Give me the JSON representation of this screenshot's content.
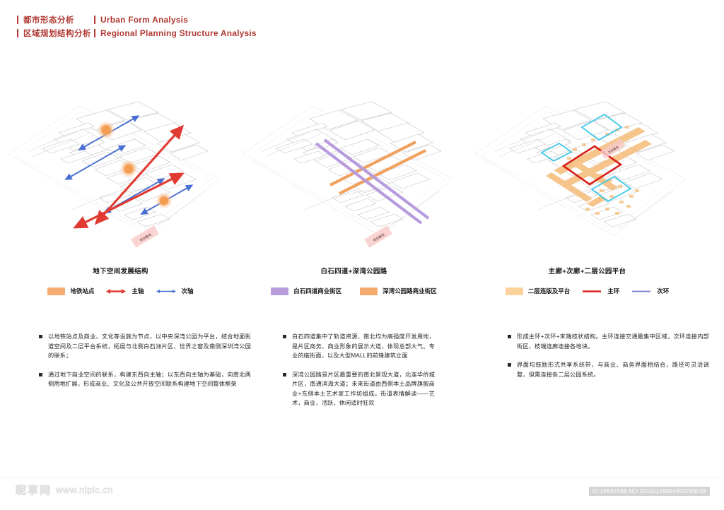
{
  "header": {
    "rows": [
      {
        "cn": "都市形态分析",
        "en": "Urban Form Analysis"
      },
      {
        "cn": "区域规划结构分析",
        "en": "Regional Planning Structure Analysis"
      }
    ],
    "accent_color": "#b03a34"
  },
  "panels": [
    {
      "title": "地下空间发展结构",
      "site_label": "项目基地",
      "legend": [
        {
          "kind": "swatch",
          "label": "地铁站点",
          "color": "#f5ad72"
        },
        {
          "kind": "double-arrow",
          "label": "主轴",
          "color": "#e03a32"
        },
        {
          "kind": "double-arrow",
          "label": "次轴",
          "color": "#4a6fd4"
        }
      ]
    },
    {
      "title": "白石四道+深湾公园路",
      "site_label": "项目基地",
      "legend": [
        {
          "kind": "swatch",
          "label": "白石四道商业街区",
          "color": "#b79bdd"
        },
        {
          "kind": "swatch",
          "label": "深湾公园路商业街区",
          "color": "#f3ab6e"
        }
      ]
    },
    {
      "title": "主廊+次廊+二层公园平台",
      "site_label": "项目基地",
      "legend": [
        {
          "kind": "swatch",
          "label": "二层连版及平台",
          "color": "#fbd29a"
        },
        {
          "kind": "line",
          "label": "主环",
          "color": "#d8201b"
        },
        {
          "kind": "line",
          "label": "次环",
          "color": "#6f7fd8"
        }
      ]
    }
  ],
  "notes": {
    "column1": [
      "以地铁站点及商业、文化等设施为节点，以中央深湾公园为平台，结合地面街道空间及二层平台系统，拓展与北侧白石洲片区、世界之窗及南侧深圳湾公园的联系；",
      "通过地下商业空间的联系，构建东西向主轴；以东西向主轴为基础，向南北两侧用地扩展，形成商业、文化及公共开放空间联系构建地下空间整体框架"
    ],
    "column2": [
      "白石四道集中了轨道资源，南北均为高强度开发用地，是片区商务、商业形象的展示大道，体现总部大气、专业的临街面，以及大型MALL的前锋建筑立面",
      "深湾公园路是片区最重要的南北景观大道，北连华侨城片区，南通滨海大道；未来街道由西侧本土品牌旗舰商业+东侧本土艺术家工作坊组成。街道表情解读——艺术，商业，活跃，休闲适时狂欢"
    ],
    "column3": [
      "形成主环+次环+末端枝状结构。主环连接交通最集中区域，次环连接内部街区，枝端连廊连接各地块。",
      "界面均鼓励形式共享系统带，与商业、商务界面相结合，路径可灵活调整，但需连接各二层公园系统。"
    ]
  },
  "footer": {
    "watermark_logo": "昵享网",
    "watermark_url": "www.nipic.cn",
    "image_id": "ID:26567569 NO:20191129094800786038"
  }
}
